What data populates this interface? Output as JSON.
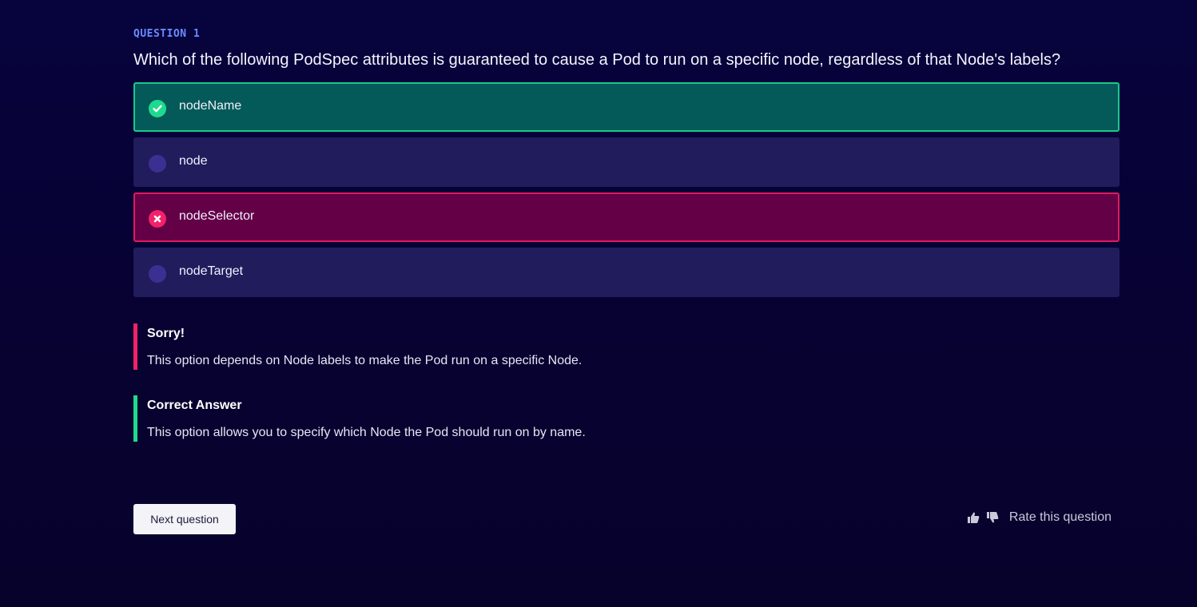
{
  "question": {
    "label": "QUESTION 1",
    "text": "Which of the following PodSpec attributes is guaranteed to cause a Pod to run on a specific node, regardless of that Node's labels?"
  },
  "options": [
    {
      "label": "nodeName",
      "state": "correct",
      "icon": "check-circle-icon"
    },
    {
      "label": "node",
      "state": "neutral",
      "icon": "radio-circle-icon"
    },
    {
      "label": "nodeSelector",
      "state": "wrong",
      "icon": "x-circle-icon"
    },
    {
      "label": "nodeTarget",
      "state": "neutral",
      "icon": "radio-circle-icon"
    }
  ],
  "feedback": {
    "wrong": {
      "title": "Sorry!",
      "text": "This option depends on Node labels to make the Pod run on a specific Node."
    },
    "correct": {
      "title": "Correct Answer",
      "text": "This option allows you to specify which Node the Pod should run on by name."
    }
  },
  "footer": {
    "next_label": "Next question",
    "rate_label": "Rate this question",
    "thumbs_up_icon": "thumbs-up-icon",
    "thumbs_down_icon": "thumbs-down-icon"
  },
  "colors": {
    "background": "#07033d",
    "accent_label": "#6b8cff",
    "correct": "#1fd98f",
    "correct_bg": "#045a58",
    "wrong": "#f2216b",
    "wrong_bg": "#640045",
    "neutral_bg": "#211c5c"
  }
}
